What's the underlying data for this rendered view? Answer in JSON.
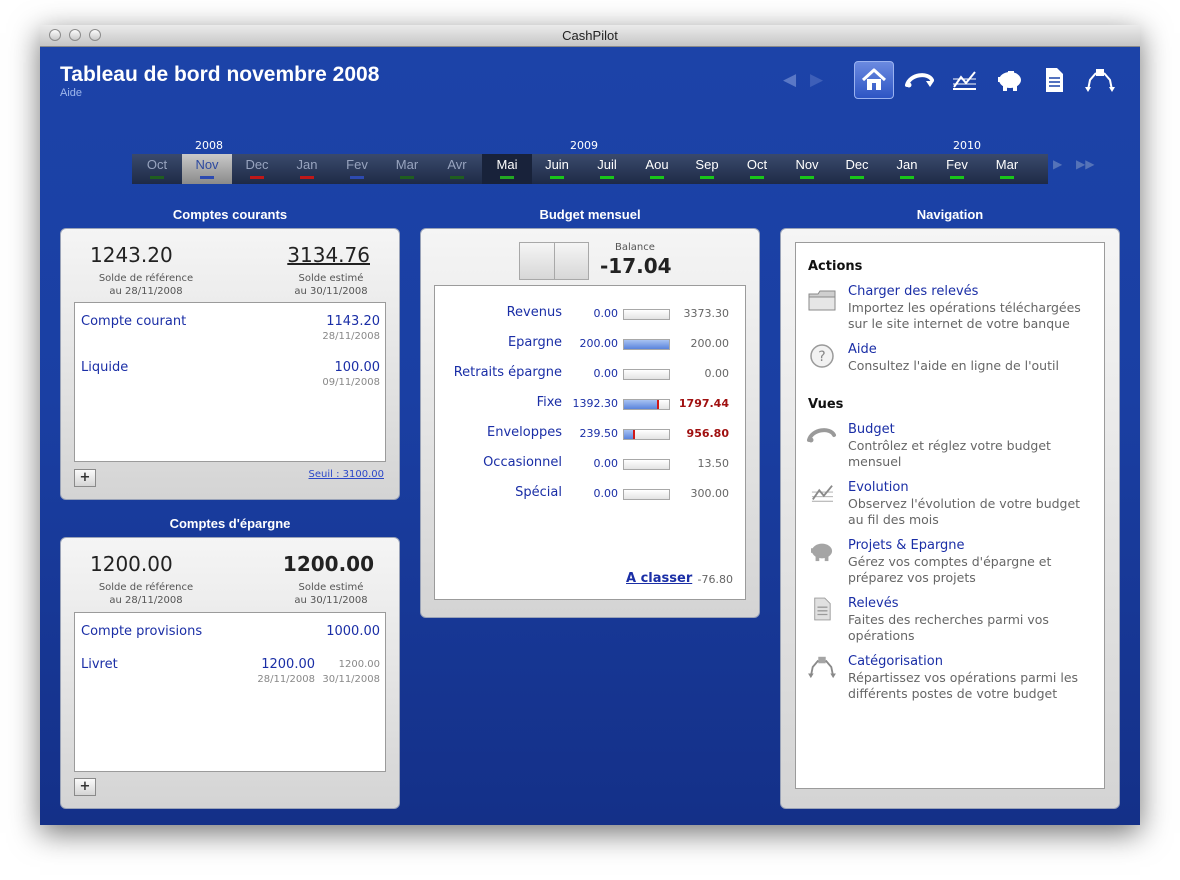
{
  "window": {
    "title": "CashPilot"
  },
  "header": {
    "title": "Tableau de bord novembre 2008",
    "help_link": "Aide",
    "prev_arrow": "◀",
    "next_arrow": "▶",
    "toolbar_icons": [
      "home-icon",
      "budget-icon",
      "evolution-icon",
      "piggy-bank-icon",
      "statements-icon",
      "categorization-icon"
    ]
  },
  "timeline": {
    "years": [
      "2008",
      "2009",
      "2010"
    ],
    "months": [
      {
        "label": "Oct",
        "state": "past",
        "marker": "#1f5e1f"
      },
      {
        "label": "Nov",
        "state": "selected",
        "marker": "#2d4ab0"
      },
      {
        "label": "Dec",
        "state": "past",
        "marker": "#c01818"
      },
      {
        "label": "Jan",
        "state": "past",
        "marker": "#c01818"
      },
      {
        "label": "Fev",
        "state": "past",
        "marker": "#2d4ab0"
      },
      {
        "label": "Mar",
        "state": "past",
        "marker": "#1f5e1f"
      },
      {
        "label": "Avr",
        "state": "past",
        "marker": "#1f5e1f"
      },
      {
        "label": "Mai",
        "state": "current",
        "marker": "#22a822"
      },
      {
        "label": "Juin",
        "state": "future",
        "marker": "#19c719"
      },
      {
        "label": "Juil",
        "state": "future",
        "marker": "#19c719"
      },
      {
        "label": "Aou",
        "state": "future",
        "marker": "#19c719"
      },
      {
        "label": "Sep",
        "state": "future",
        "marker": "#19c719"
      },
      {
        "label": "Oct",
        "state": "future",
        "marker": "#19c719"
      },
      {
        "label": "Nov",
        "state": "future",
        "marker": "#19c719"
      },
      {
        "label": "Dec",
        "state": "future",
        "marker": "#19c719"
      },
      {
        "label": "Jan",
        "state": "future",
        "marker": "#19c719"
      },
      {
        "label": "Fev",
        "state": "future",
        "marker": "#19c719"
      },
      {
        "label": "Mar",
        "state": "future",
        "marker": "#19c719"
      }
    ],
    "scroll_next": "▶",
    "scroll_end": "▶▶"
  },
  "comptes_courants": {
    "title": "Comptes courants",
    "reference_balance": "1243.20",
    "reference_label": "Solde de référence",
    "reference_date": "au 28/11/2008",
    "estimated_balance": "3134.76",
    "estimated_label": "Solde estimé",
    "estimated_date": "au 30/11/2008",
    "accounts": [
      {
        "name": "Compte courant",
        "amount": "1143.20",
        "date": "28/11/2008"
      },
      {
        "name": "Liquide",
        "amount": "100.00",
        "date": "09/11/2008"
      }
    ],
    "add_button": "+",
    "threshold": "Seuil : 3100.00"
  },
  "comptes_epargne": {
    "title": "Comptes d'épargne",
    "reference_balance": "1200.00",
    "reference_label": "Solde de référence",
    "reference_date": "au 28/11/2008",
    "estimated_balance": "1200.00",
    "estimated_label": "Solde estimé",
    "estimated_date": "au 30/11/2008",
    "accounts": [
      {
        "name": "Compte provisions",
        "amount": "1000.00",
        "date": "",
        "amount2": "",
        "date2": ""
      },
      {
        "name": "Livret",
        "amount": "1200.00",
        "date": "28/11/2008",
        "amount2": "1200.00",
        "date2": "30/11/2008"
      }
    ],
    "add_button": "+"
  },
  "budget": {
    "title": "Budget mensuel",
    "balance_label": "Balance",
    "balance_value": "-17.04",
    "rows": [
      {
        "label": "Revenus",
        "actual": "0.00",
        "planned": "3373.30",
        "fill": 0.0,
        "over": false
      },
      {
        "label": "Epargne",
        "actual": "200.00",
        "planned": "200.00",
        "fill": 1.0,
        "over": false
      },
      {
        "label": "Retraits épargne",
        "actual": "0.00",
        "planned": "0.00",
        "fill": 0.0,
        "over": false
      },
      {
        "label": "Fixe",
        "actual": "1392.30",
        "planned": "1797.44",
        "fill": 0.77,
        "over": true
      },
      {
        "label": "Enveloppes",
        "actual": "239.50",
        "planned": "956.80",
        "fill": 0.25,
        "over": true
      },
      {
        "label": "Occasionnel",
        "actual": "0.00",
        "planned": "13.50",
        "fill": 0.0,
        "over": false
      },
      {
        "label": "Spécial",
        "actual": "0.00",
        "planned": "300.00",
        "fill": 0.0,
        "over": false
      }
    ],
    "unclassified_link": "A classer",
    "unclassified_value": "-76.80"
  },
  "navigation": {
    "title": "Navigation",
    "actions_heading": "Actions",
    "actions": [
      {
        "icon": "folder-icon",
        "name": "Charger des relevés",
        "desc": [
          "Importez les opérations téléchargées",
          "sur le site internet de votre banque"
        ]
      },
      {
        "icon": "help-icon",
        "name": "Aide",
        "desc": [
          "Consultez l'aide en ligne de l'outil"
        ]
      }
    ],
    "views_heading": "Vues",
    "views": [
      {
        "icon": "budget-icon",
        "name": "Budget",
        "desc": [
          "Contrôlez et réglez votre budget",
          "mensuel"
        ]
      },
      {
        "icon": "evolution-icon",
        "name": "Evolution",
        "desc": [
          "Observez l'évolution de votre budget",
          "au fil des mois"
        ]
      },
      {
        "icon": "piggy-bank-icon",
        "name": "Projets & Epargne",
        "desc": [
          "Gérez vos comptes d'épargne et",
          "préparez vos projets"
        ]
      },
      {
        "icon": "statements-icon",
        "name": "Relevés",
        "desc": [
          "Faites des recherches parmi vos",
          "opérations"
        ]
      },
      {
        "icon": "categorization-icon",
        "name": "Catégorisation",
        "desc": [
          "Répartissez vos opérations parmi les",
          "différents postes de votre budget"
        ]
      }
    ]
  }
}
